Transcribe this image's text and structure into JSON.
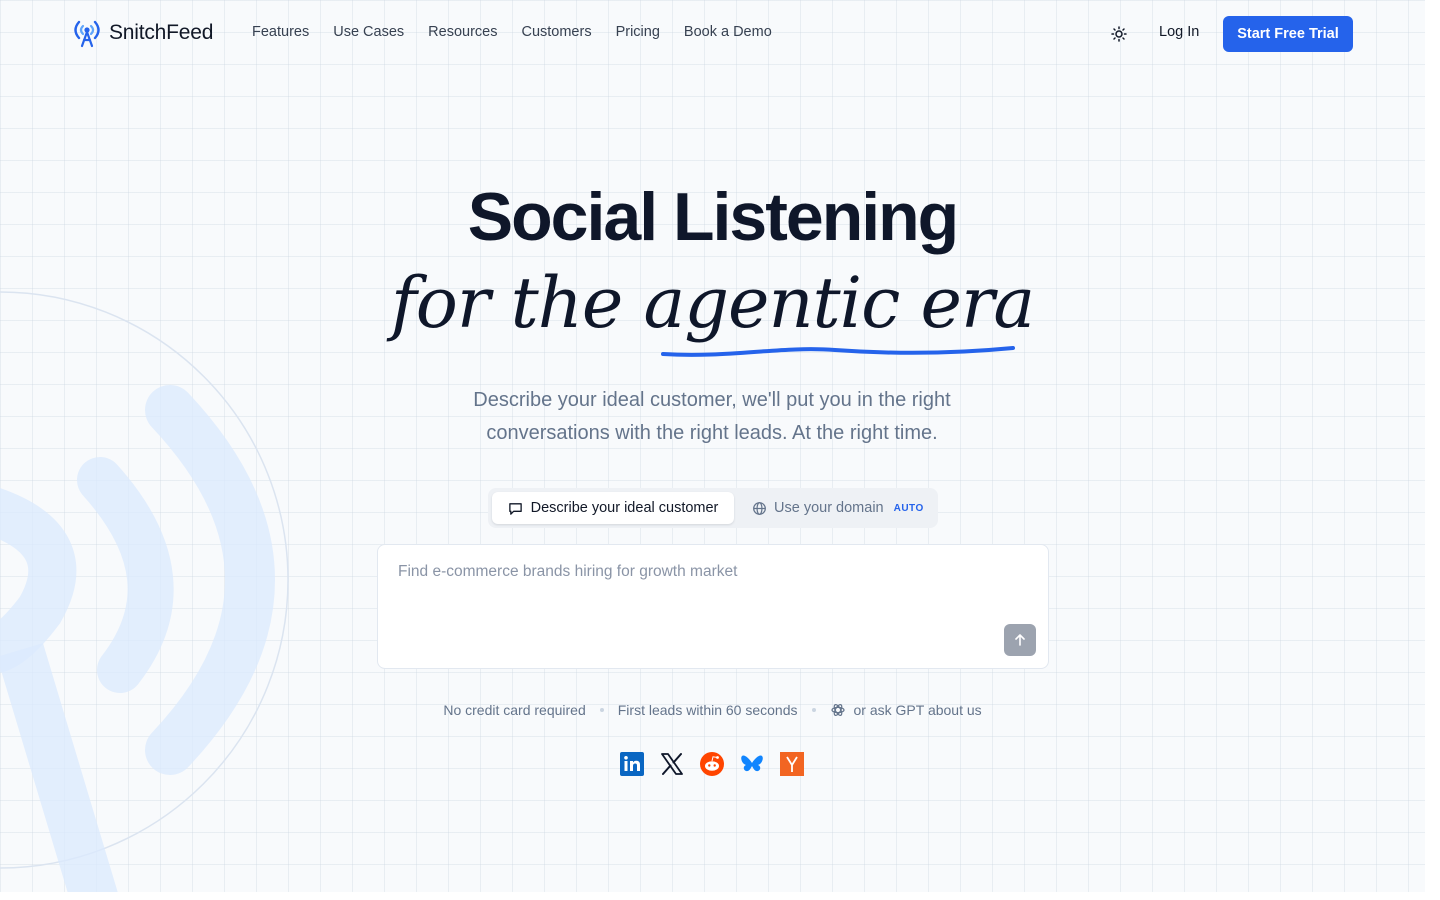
{
  "brand": {
    "name": "SnitchFeed",
    "accent": "#2563eb"
  },
  "nav": {
    "links": [
      "Features",
      "Use Cases",
      "Resources",
      "Customers",
      "Pricing",
      "Book a Demo"
    ],
    "login": "Log In",
    "cta": "Start Free Trial",
    "theme_icon": "sun-icon"
  },
  "hero": {
    "title": "Social Listening",
    "script": "for the agentic era",
    "subtitle": "Describe your ideal customer, we'll put you in the right conversations with the right leads. At the right time."
  },
  "modes": {
    "active": {
      "label": "Describe your ideal customer",
      "icon": "chat-icon"
    },
    "alt": {
      "label": "Use your domain",
      "badge": "AUTO",
      "icon": "globe-icon"
    }
  },
  "prompt": {
    "placeholder": "Find e-commerce brands hiring for growth market",
    "submit_icon": "arrow-up-icon"
  },
  "notes": {
    "no_card": "No credit card required",
    "first_leads": "First leads within 60 seconds",
    "ask_gpt": "or ask GPT about us"
  },
  "socials": [
    "linkedin-icon",
    "x-icon",
    "reddit-icon",
    "bluesky-icon",
    "ycombinator-icon"
  ]
}
